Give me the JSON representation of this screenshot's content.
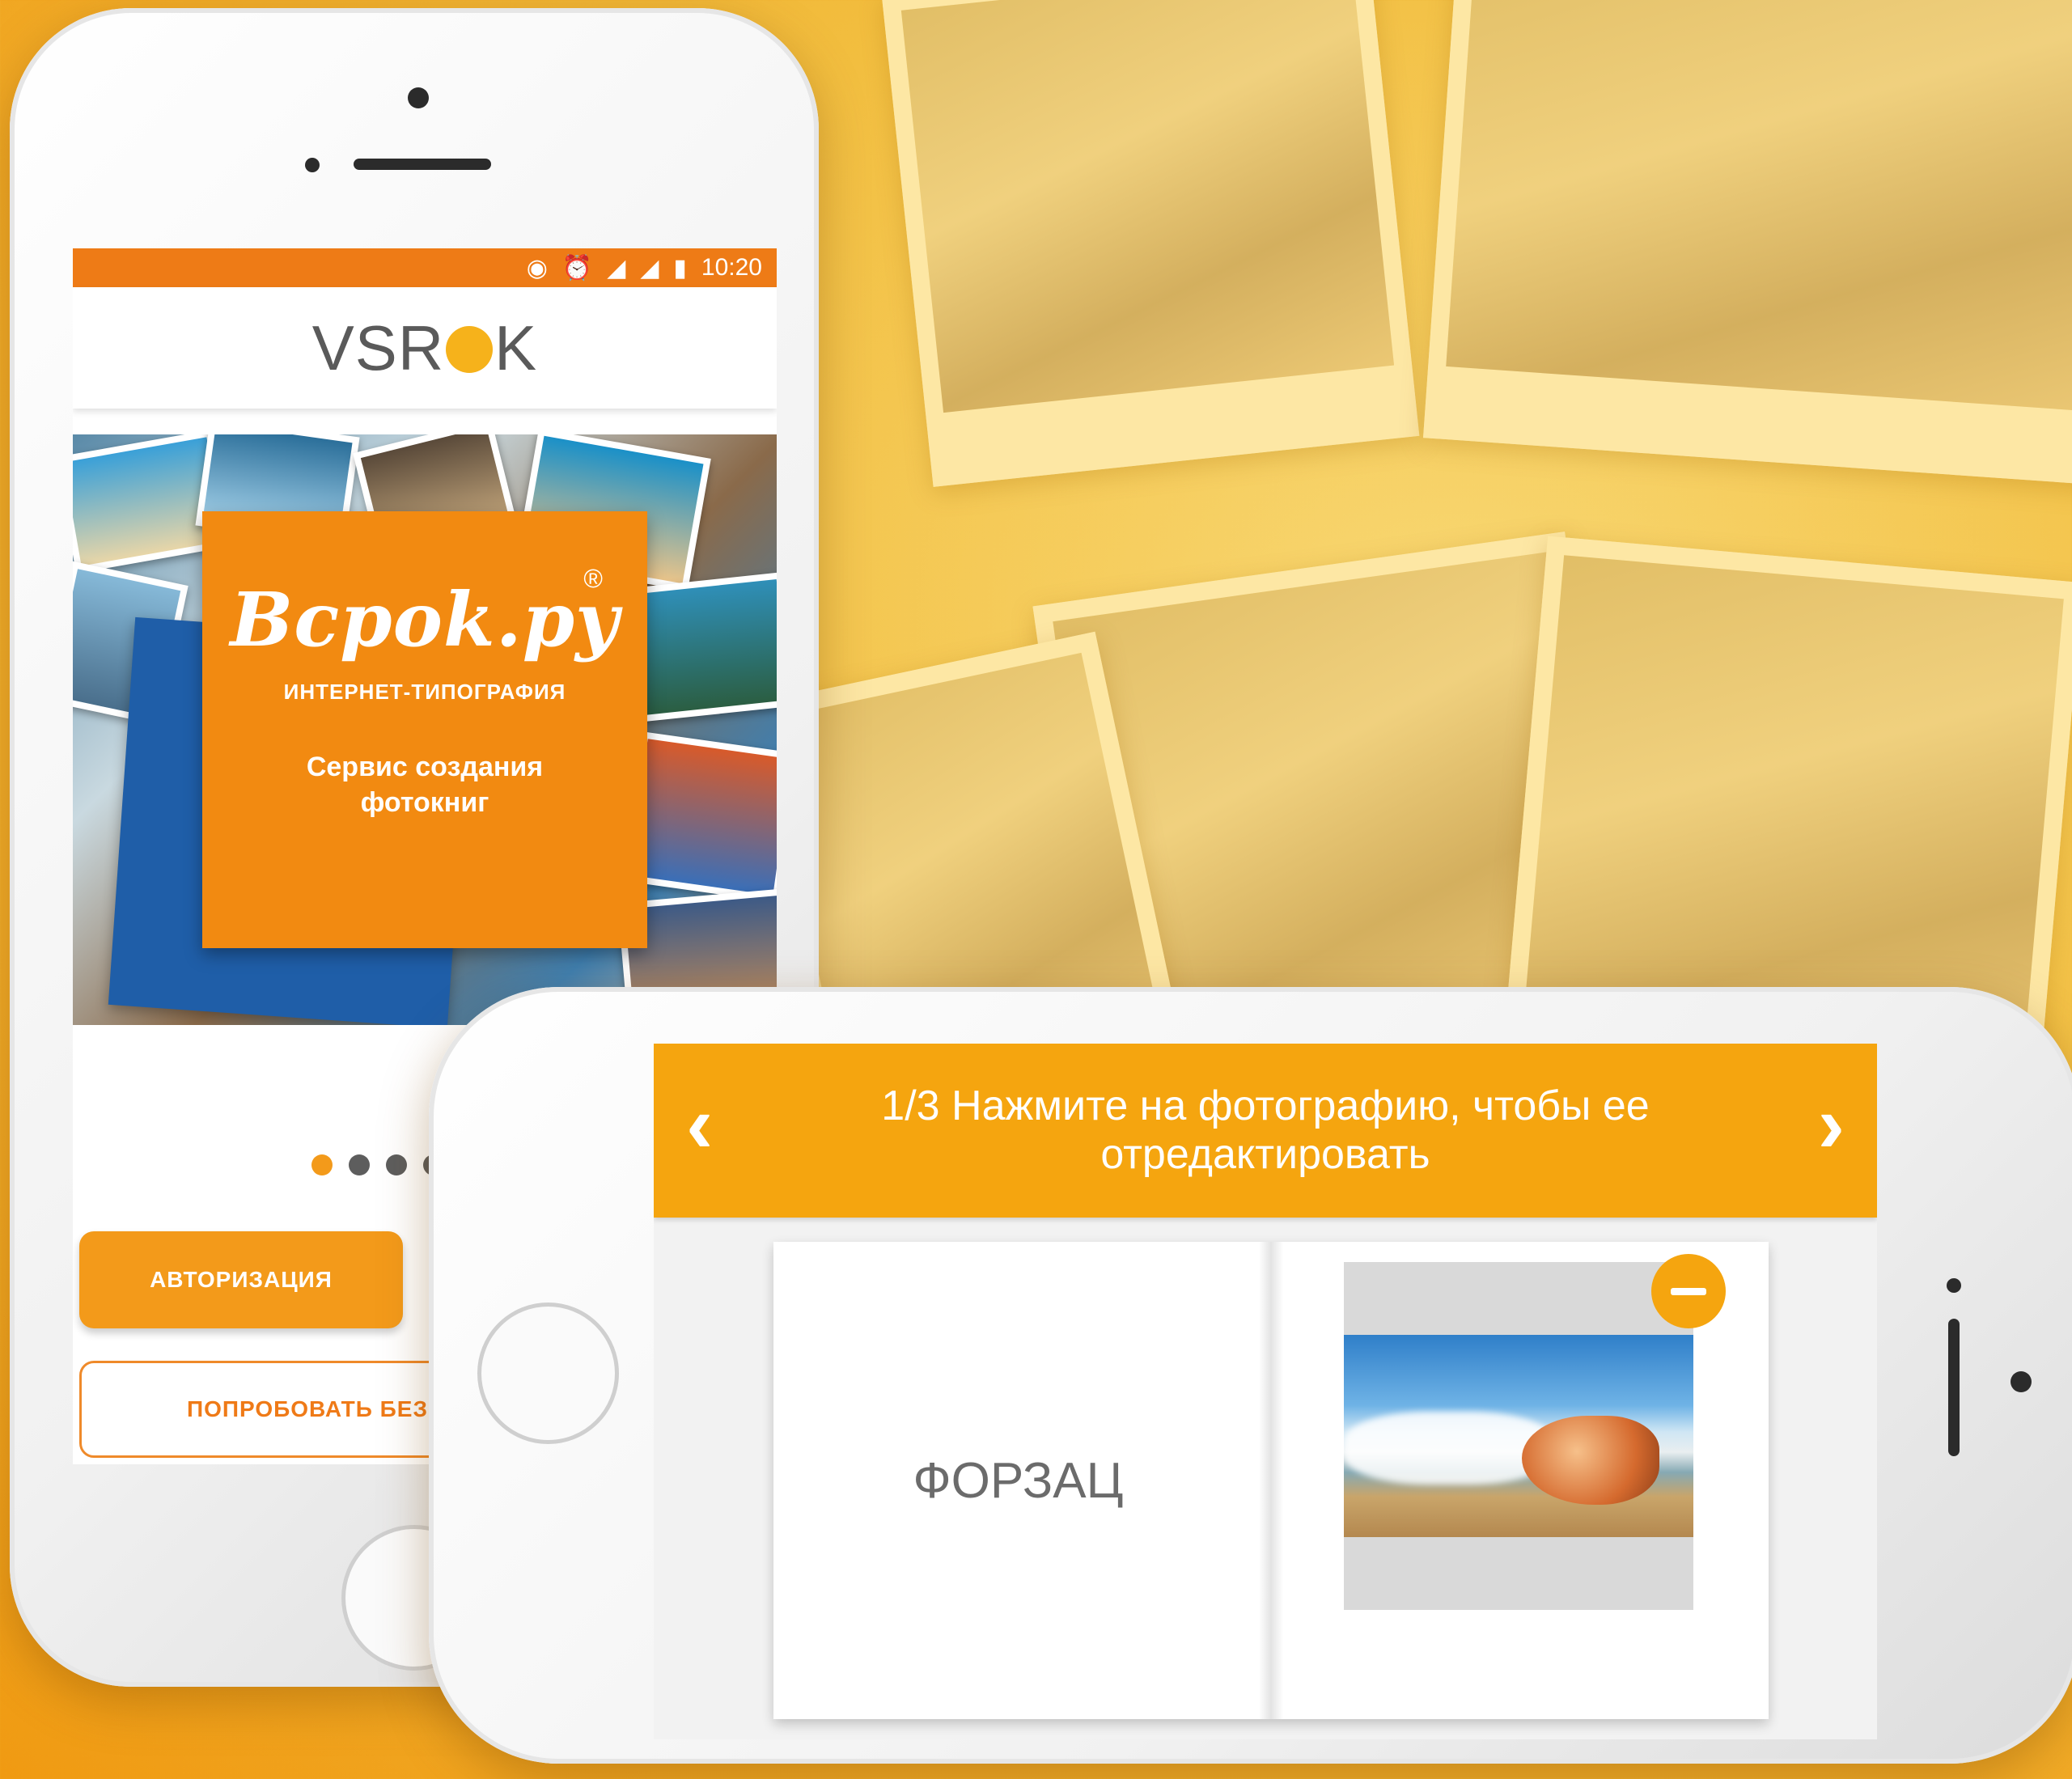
{
  "phone_portrait": {
    "status_bar": {
      "time": "10:20",
      "icons": [
        "vibrate-icon",
        "alarm-icon",
        "signal-icon",
        "data-signal-icon",
        "battery-icon"
      ]
    },
    "app_logo": {
      "prefix": "VSR",
      "suffix": "K"
    },
    "banner": {
      "brand": "Вcpok.py",
      "registered": "®",
      "subtitle": "ИНТЕРНЕТ-ТИПОГРАФИЯ",
      "description_line1": "Сервис создания",
      "description_line2": "фотокниг"
    },
    "pager": {
      "count": 4,
      "active": 0
    },
    "buttons": {
      "auth_label": "АВТОРИЗАЦИЯ",
      "try_label": "ПОПРОБОВАТЬ БЕЗ"
    }
  },
  "phone_landscape": {
    "header": {
      "step": "1/3",
      "line1": "1/3 Нажмите на фотографию, чтобы ее",
      "line2": "отредактировать"
    },
    "left_page_label": "ФОРЗАЦ"
  },
  "colors": {
    "accent": "#f5a50f",
    "statusbar": "#ee7b16",
    "brand_card": "#f28a11",
    "book_blue": "#1f5ea8"
  }
}
